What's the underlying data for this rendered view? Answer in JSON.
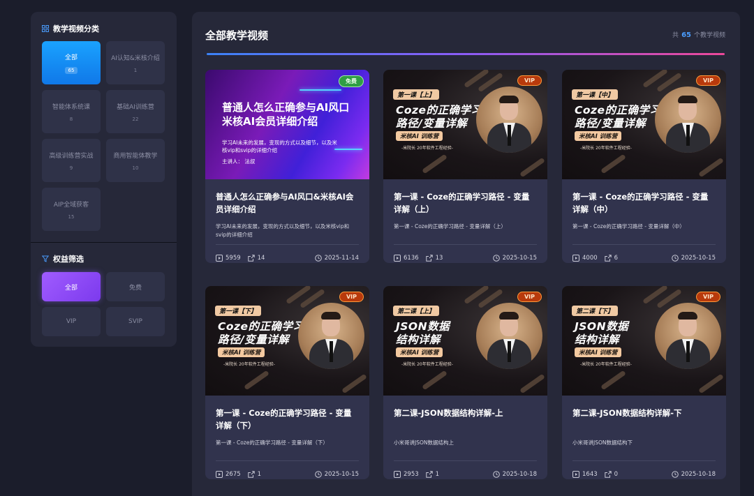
{
  "sidebar": {
    "categories_title": "教学视频分类",
    "categories": [
      {
        "label": "全部",
        "count": "65",
        "active": true
      },
      {
        "label": "AI认知&米核介绍",
        "count": "1",
        "active": false
      },
      {
        "label": "智能体系统课",
        "count": "8",
        "active": false
      },
      {
        "label": "基础AI训练营",
        "count": "22",
        "active": false
      },
      {
        "label": "高级训练营实战",
        "count": "9",
        "active": false
      },
      {
        "label": "商用智能体教学",
        "count": "10",
        "active": false
      },
      {
        "label": "AIP全域获客",
        "count": "15",
        "active": false
      }
    ],
    "permission_title": "权益筛选",
    "permissions": [
      {
        "label": "全部",
        "active": true
      },
      {
        "label": "免费",
        "active": false
      },
      {
        "label": "VIP",
        "active": false
      },
      {
        "label": "SVIP",
        "active": false
      }
    ]
  },
  "main": {
    "title": "全部教学视频",
    "count_prefix": "共",
    "count": "65",
    "count_suffix": "个教学视频"
  },
  "videos": [
    {
      "badge": "免费",
      "badge_type": "free",
      "thumb": {
        "line1": "普通人怎么正确参与AI风口",
        "line2": "米核AI会员详细介绍",
        "sub": "学习AI未来的发展，变现的方式以及细节，以及米核vip和svip的详细介绍",
        "speaker": "主讲人：  法叔"
      },
      "title": "普通人怎么正确参与AI风口&米核AI会员详细介绍",
      "desc": "学习AI未来的发展，变现的方式以及细节，以及米核vip和svip的详细介绍",
      "views": "5959",
      "shares": "14",
      "date": "2025-11-14"
    },
    {
      "badge": "VIP",
      "badge_type": "vip",
      "thumb": {
        "lesson": "第一课【上】",
        "big1": "Coze的正确学习",
        "big2": "路径/变量详解",
        "tag": "米核AI 训练营",
        "small": "-米院长 20年软件工程经验-"
      },
      "title": "第一课 - Coze的正确学习路径 - 变量详解（上）",
      "desc": "第一课 - Coze的正确学习路径 - 变量详解（上）",
      "views": "6136",
      "shares": "13",
      "date": "2025-10-15"
    },
    {
      "badge": "VIP",
      "badge_type": "vip",
      "thumb": {
        "lesson": "第一课【中】",
        "big1": "Coze的正确学习",
        "big2": "路径/变量详解",
        "tag": "米核AI 训练营",
        "small": "-米院长 20年软件工程经验-"
      },
      "title": "第一课 - Coze的正确学习路径 - 变量详解（中）",
      "desc": "第一课 - Coze的正确学习路径 - 变量详解（中）",
      "views": "4000",
      "shares": "6",
      "date": "2025-10-15"
    },
    {
      "badge": "VIP",
      "badge_type": "vip",
      "thumb": {
        "lesson": "第一课【下】",
        "big1": "Coze的正确学习",
        "big2": "路径/变量详解",
        "tag": "米核AI 训练营",
        "small": "-米院长 20年软件工程经验-"
      },
      "title": "第一课 - Coze的正确学习路径 - 变量详解（下）",
      "desc": "第一课 - Coze的正确学习路径 - 变量详解（下）",
      "views": "2675",
      "shares": "1",
      "date": "2025-10-15"
    },
    {
      "badge": "VIP",
      "badge_type": "vip",
      "thumb": {
        "lesson": "第二课【上】",
        "big1": "JSON数据",
        "big2": "结构详解",
        "tag": "米核AI 训练营",
        "small": "-米院长 20年软件工程经验-"
      },
      "title": "第二课-JSON数据结构详解-上",
      "desc": "小米哥讲JSON数据结构上",
      "views": "2953",
      "shares": "1",
      "date": "2025-10-18"
    },
    {
      "badge": "VIP",
      "badge_type": "vip",
      "thumb": {
        "lesson": "第二课【下】",
        "big1": "JSON数据",
        "big2": "结构详解",
        "tag": "米核AI 训练营",
        "small": "-米院长 20年软件工程经验-"
      },
      "title": "第二课-JSON数据结构详解-下",
      "desc": "小米哥讲JSON数据结构下",
      "views": "1643",
      "shares": "0",
      "date": "2025-10-18"
    }
  ],
  "colors": {
    "accent_blue": "#1aa2ff",
    "accent_purple": "#8b5cf6",
    "free_badge": "#2f9e44",
    "vip_badge": "#b83a0c"
  },
  "icons": {
    "category_section": "grid-icon",
    "permission_section": "filter-icon",
    "views": "play-icon",
    "shares": "share-icon",
    "date": "clock-icon"
  }
}
